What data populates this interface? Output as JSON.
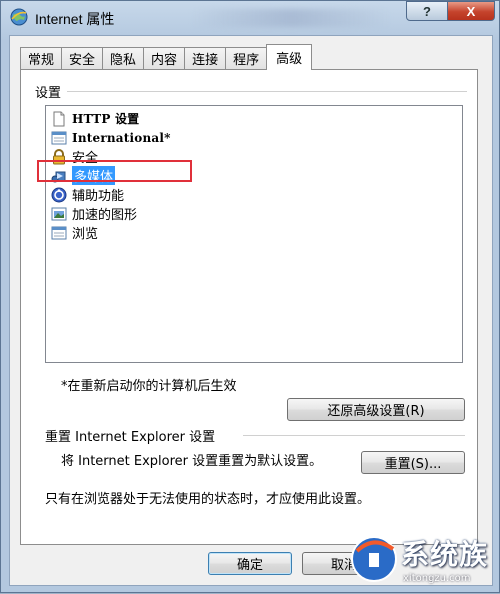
{
  "window": {
    "title": "Internet 属性",
    "help_label": "?",
    "close_label": "X"
  },
  "tabs": [
    {
      "label": "常规"
    },
    {
      "label": "安全"
    },
    {
      "label": "隐私"
    },
    {
      "label": "内容"
    },
    {
      "label": "连接"
    },
    {
      "label": "程序"
    },
    {
      "label": "高级",
      "active": true
    }
  ],
  "settings": {
    "group_label": "设置",
    "items": [
      {
        "label": "HTTP 设置",
        "icon": "page-icon"
      },
      {
        "label": "International*",
        "icon": "window-icon"
      },
      {
        "label": "安全",
        "icon": "lock-icon"
      },
      {
        "label": "多媒体",
        "icon": "multimedia-icon",
        "selected": true
      },
      {
        "label": "辅助功能",
        "icon": "accessibility-icon"
      },
      {
        "label": "加速的图形",
        "icon": "graphics-icon"
      },
      {
        "label": "浏览",
        "icon": "window-icon"
      }
    ],
    "restart_note": "*在重新启动你的计算机后生效",
    "restore_button": "还原高级设置(R)"
  },
  "reset": {
    "group_label": "重置 Internet Explorer 设置",
    "description": "将 Internet Explorer 设置重置为默认设置。",
    "reset_button": "重置(S)...",
    "note": "只有在浏览器处于无法使用的状态时，才应使用此设置。"
  },
  "footer": {
    "ok_button": "确定",
    "cancel_button": "取消"
  },
  "watermark": {
    "brand": "系统族",
    "url": "xitongzu.com"
  },
  "colors": {
    "selection": "#3399ff",
    "highlight_box": "#e0303a",
    "close_button": "#c5432c"
  }
}
